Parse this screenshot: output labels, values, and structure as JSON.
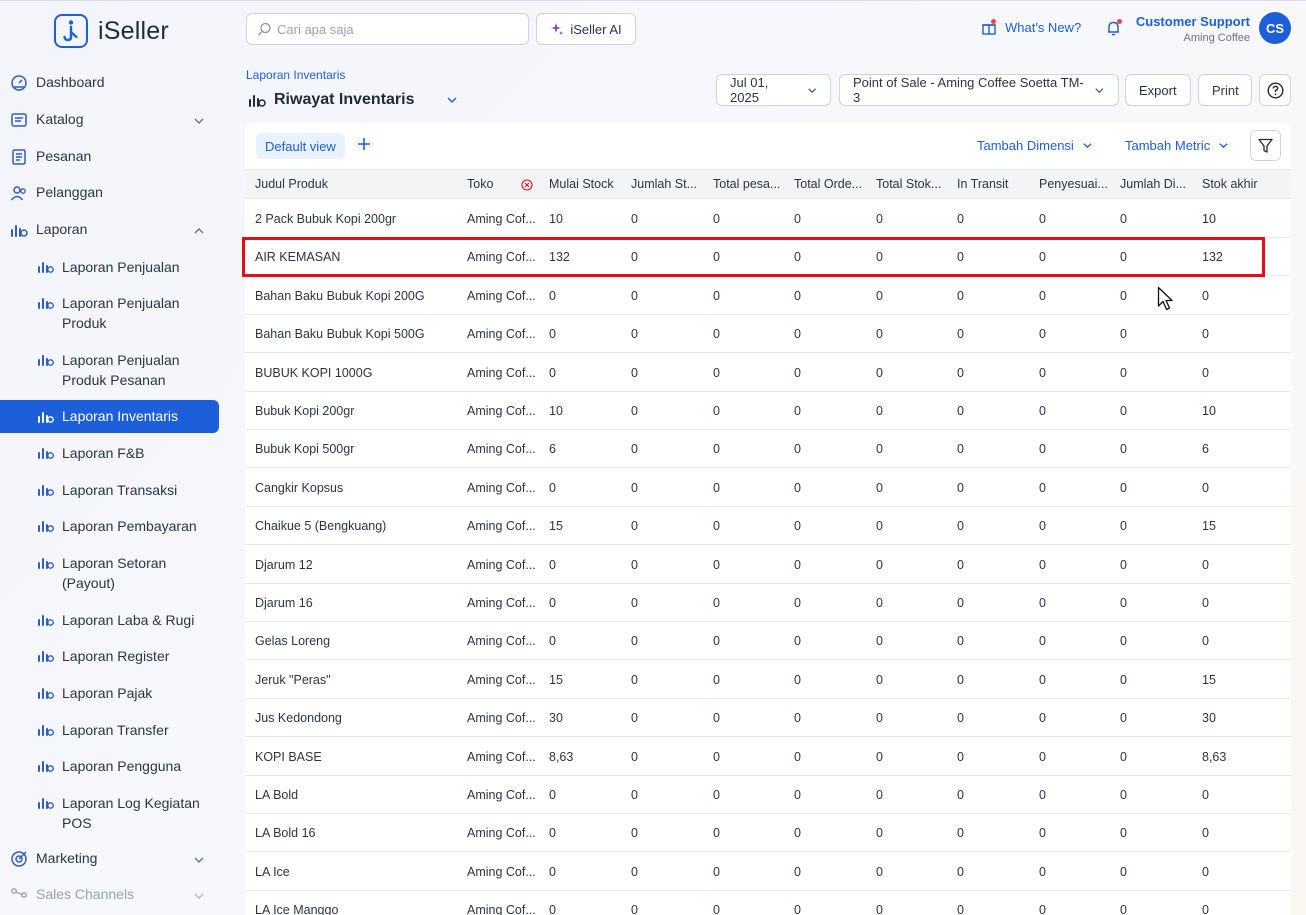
{
  "app": {
    "name": "iSeller"
  },
  "search": {
    "placeholder": "Cari apa saja"
  },
  "ai_button": "iSeller AI",
  "whats_new": "What's New?",
  "user": {
    "name": "Customer Support",
    "store": "Aming Coffee",
    "initials": "CS"
  },
  "nav": {
    "dashboard": "Dashboard",
    "katalog": "Katalog",
    "pesanan": "Pesanan",
    "pelanggan": "Pelanggan",
    "laporan": "Laporan",
    "marketing": "Marketing",
    "sales_channels": "Sales Channels",
    "reports": [
      "Laporan Penjualan",
      "Laporan Penjualan Produk",
      "Laporan Penjualan Produk Pesanan",
      "Laporan Inventaris",
      "Laporan F&B",
      "Laporan Transaksi",
      "Laporan Pembayaran",
      "Laporan Setoran (Payout)",
      "Laporan Laba & Rugi",
      "Laporan Register",
      "Laporan Pajak",
      "Laporan Transfer",
      "Laporan Pengguna",
      "Laporan Log Kegiatan POS"
    ]
  },
  "breadcrumb": "Laporan Inventaris",
  "page_title": "Riwayat Inventaris",
  "toolbar": {
    "date": "Jul 01, 2025",
    "outlet": "Point of Sale - Aming Coffee Soetta TM-3",
    "export": "Export",
    "print": "Print"
  },
  "view": {
    "default_view": "Default view",
    "add_dimension": "Tambah Dimensi",
    "add_metric": "Tambah Metric"
  },
  "columns": [
    "Judul Produk",
    "Toko",
    "Mulai Stock",
    "Jumlah St...",
    "Total pesa...",
    "Total Orde...",
    "Total Stok...",
    "In Transit",
    "Penyesuai...",
    "Jumlah Di...",
    "Stok akhir"
  ],
  "rows": [
    [
      "2 Pack Bubuk Kopi 200gr",
      "Aming Cof...",
      "10",
      "0",
      "0",
      "0",
      "0",
      "0",
      "0",
      "0",
      "10"
    ],
    [
      "AIR KEMASAN",
      "Aming Cof...",
      "132",
      "0",
      "0",
      "0",
      "0",
      "0",
      "0",
      "0",
      "132"
    ],
    [
      "Bahan Baku Bubuk Kopi 200G",
      "Aming Cof...",
      "0",
      "0",
      "0",
      "0",
      "0",
      "0",
      "0",
      "0",
      "0"
    ],
    [
      "Bahan Baku Bubuk Kopi 500G",
      "Aming Cof...",
      "0",
      "0",
      "0",
      "0",
      "0",
      "0",
      "0",
      "0",
      "0"
    ],
    [
      "BUBUK KOPI 1000G",
      "Aming Cof...",
      "0",
      "0",
      "0",
      "0",
      "0",
      "0",
      "0",
      "0",
      "0"
    ],
    [
      "Bubuk Kopi 200gr",
      "Aming Cof...",
      "10",
      "0",
      "0",
      "0",
      "0",
      "0",
      "0",
      "0",
      "10"
    ],
    [
      "Bubuk Kopi 500gr",
      "Aming Cof...",
      "6",
      "0",
      "0",
      "0",
      "0",
      "0",
      "0",
      "0",
      "6"
    ],
    [
      "Cangkir Kopsus",
      "Aming Cof...",
      "0",
      "0",
      "0",
      "0",
      "0",
      "0",
      "0",
      "0",
      "0"
    ],
    [
      "Chaikue 5 (Bengkuang)",
      "Aming Cof...",
      "15",
      "0",
      "0",
      "0",
      "0",
      "0",
      "0",
      "0",
      "15"
    ],
    [
      "Djarum 12",
      "Aming Cof...",
      "0",
      "0",
      "0",
      "0",
      "0",
      "0",
      "0",
      "0",
      "0"
    ],
    [
      "Djarum 16",
      "Aming Cof...",
      "0",
      "0",
      "0",
      "0",
      "0",
      "0",
      "0",
      "0",
      "0"
    ],
    [
      "Gelas Loreng",
      "Aming Cof...",
      "0",
      "0",
      "0",
      "0",
      "0",
      "0",
      "0",
      "0",
      "0"
    ],
    [
      "Jeruk \"Peras\"",
      "Aming Cof...",
      "15",
      "0",
      "0",
      "0",
      "0",
      "0",
      "0",
      "0",
      "15"
    ],
    [
      "Jus Kedondong",
      "Aming Cof...",
      "30",
      "0",
      "0",
      "0",
      "0",
      "0",
      "0",
      "0",
      "30"
    ],
    [
      "KOPI BASE",
      "Aming Cof...",
      "8,63",
      "0",
      "0",
      "0",
      "0",
      "0",
      "0",
      "0",
      "8,63"
    ],
    [
      "LA Bold",
      "Aming Cof...",
      "0",
      "0",
      "0",
      "0",
      "0",
      "0",
      "0",
      "0",
      "0"
    ],
    [
      "LA Bold 16",
      "Aming Cof...",
      "0",
      "0",
      "0",
      "0",
      "0",
      "0",
      "0",
      "0",
      "0"
    ],
    [
      "LA Ice",
      "Aming Cof...",
      "0",
      "0",
      "0",
      "0",
      "0",
      "0",
      "0",
      "0",
      "0"
    ],
    [
      "LA Ice Manggo",
      "Aming Cof...",
      "0",
      "0",
      "0",
      "0",
      "0",
      "0",
      "0",
      "0",
      "0"
    ]
  ]
}
